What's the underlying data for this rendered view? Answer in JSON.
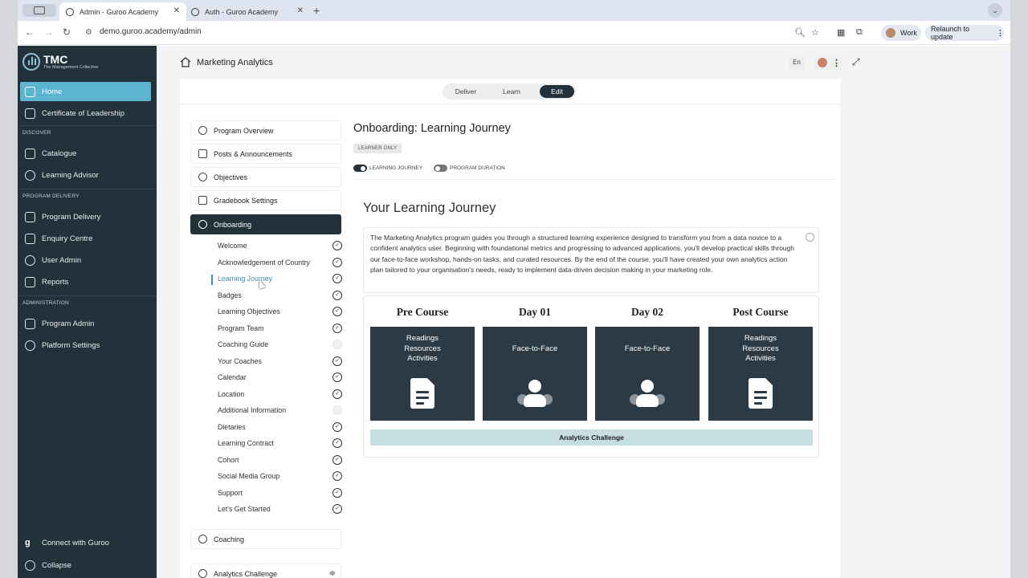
{
  "browser": {
    "tabs": [
      {
        "label": "Admin - Guroo Academy",
        "active": true
      },
      {
        "label": "Auth - Guroo Academy",
        "active": false
      }
    ],
    "url": "demo.guroo.academy/admin",
    "profile_label": "Work",
    "relaunch_label": "Relaunch to update"
  },
  "sidebar": {
    "logo_title": "TMC",
    "logo_sub": "The Management Collective",
    "items": [
      {
        "label": "Home"
      },
      {
        "label": "Certificate of Leadership"
      },
      {
        "label": "Catalogue"
      },
      {
        "label": "Learning Advisor"
      },
      {
        "label": "Program Delivery"
      },
      {
        "label": "Enquiry Centre"
      },
      {
        "label": "User Admin"
      },
      {
        "label": "Reports"
      },
      {
        "label": "Program Admin"
      },
      {
        "label": "Platform Settings"
      }
    ],
    "sections": [
      "DISCOVER",
      "PROGRAM DELIVERY",
      "ADMINISTRATION"
    ],
    "footer": {
      "connect": "Connect with Guroo",
      "collapse": "Collapse"
    }
  },
  "header": {
    "title": "Marketing Analytics",
    "lang": "En"
  },
  "mode_switch": [
    "Deliver",
    "Learn",
    "Edit"
  ],
  "left_nav": {
    "cards": [
      {
        "label": "Program Overview"
      },
      {
        "label": "Posts & Announcements"
      },
      {
        "label": "Objectives"
      },
      {
        "label": "Gradebook Settings"
      },
      {
        "label": "Onboarding"
      },
      {
        "label": "Coaching"
      },
      {
        "label": "Analytics Challenge"
      }
    ],
    "onboarding_items": [
      {
        "label": "Welcome"
      },
      {
        "label": "Acknowledgement of Country"
      },
      {
        "label": "Learning Journey"
      },
      {
        "label": "Badges"
      },
      {
        "label": "Learning Objectives"
      },
      {
        "label": "Program Team"
      },
      {
        "label": "Coaching Guide"
      },
      {
        "label": "Your Coaches"
      },
      {
        "label": "Calendar"
      },
      {
        "label": "Location"
      },
      {
        "label": "Additional Information"
      },
      {
        "label": "Dietaries"
      },
      {
        "label": "Learning Contract"
      },
      {
        "label": "Cohort"
      },
      {
        "label": "Social Media Group"
      },
      {
        "label": "Support"
      },
      {
        "label": "Let's Get Started"
      }
    ]
  },
  "main": {
    "title": "Onboarding: Learning Journey",
    "badge": "LEARNER ONLY",
    "toggles": [
      {
        "label": "LEARNING JOURNEY"
      },
      {
        "label": "PROGRAM DURATION"
      }
    ],
    "section_title": "Your Learning Journey",
    "description": "The Marketing Analytics program guides you through a structured learning experience designed to transform you from a data novice to a confident analytics user. Beginning with foundational metrics and progressing to advanced applications, you'll develop practical skills through our face-to-face workshop, hands-on tasks, and curated resources. By the end of the course, you'll have created your own analytics action plan tailored to your organisation's needs, ready to implement data-driven decision making in your marketing role.",
    "phases": [
      {
        "title": "Pre Course",
        "lines": [
          "Readings",
          "Resources",
          "Activities"
        ]
      },
      {
        "title": "Day 01",
        "lines": [
          "Face-to-Face"
        ]
      },
      {
        "title": "Day 02",
        "lines": [
          "Face-to-Face"
        ]
      },
      {
        "title": "Post Course",
        "lines": [
          "Readings",
          "Resources",
          "Activities"
        ]
      }
    ],
    "challenge": "Analytics Challenge"
  }
}
